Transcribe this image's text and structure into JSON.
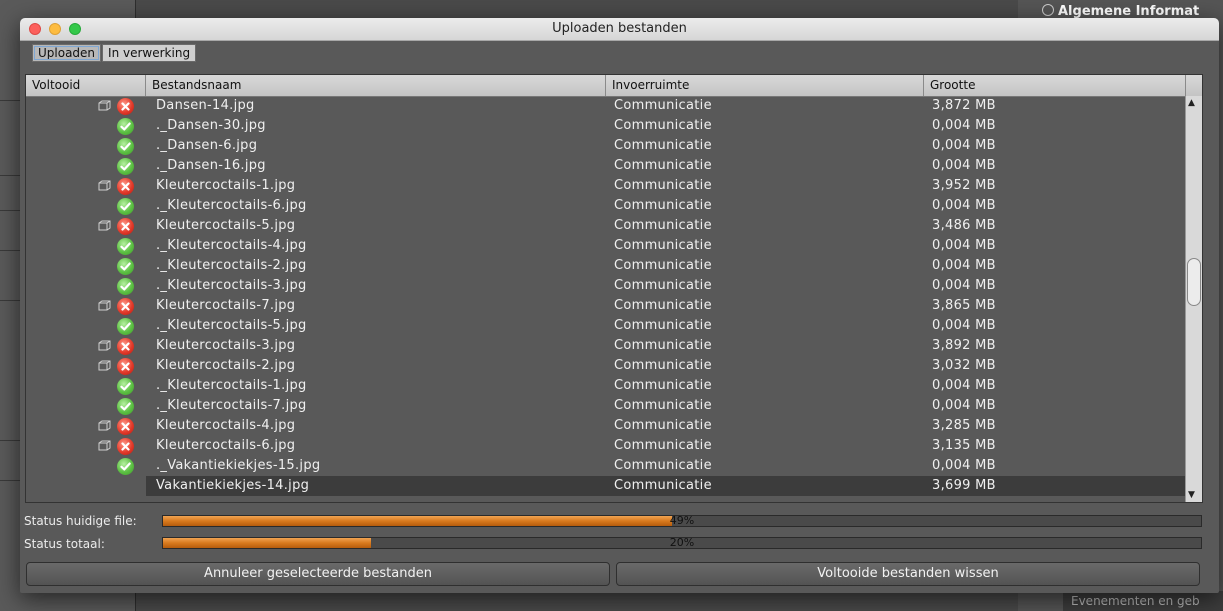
{
  "window": {
    "title": "Uploaden bestanden"
  },
  "tabs": [
    {
      "label": "Uploaden",
      "active": true
    },
    {
      "label": "In verwerking",
      "active": false
    }
  ],
  "table": {
    "columns": [
      "Voltooid",
      "Bestandsnaam",
      "Invoerruimte",
      "Grootte"
    ],
    "rows": [
      {
        "status": "error",
        "name": "Dansen-14.jpg",
        "space": "Communicatie",
        "size": "3,872 MB"
      },
      {
        "status": "ok",
        "name": "._Dansen-30.jpg",
        "space": "Communicatie",
        "size": "0,004 MB"
      },
      {
        "status": "ok",
        "name": "._Dansen-6.jpg",
        "space": "Communicatie",
        "size": "0,004 MB"
      },
      {
        "status": "ok",
        "name": "._Dansen-16.jpg",
        "space": "Communicatie",
        "size": "0,004 MB"
      },
      {
        "status": "error",
        "name": "Kleutercoctails-1.jpg",
        "space": "Communicatie",
        "size": "3,952 MB"
      },
      {
        "status": "ok",
        "name": "._Kleutercoctails-6.jpg",
        "space": "Communicatie",
        "size": "0,004 MB"
      },
      {
        "status": "error",
        "name": "Kleutercoctails-5.jpg",
        "space": "Communicatie",
        "size": "3,486 MB"
      },
      {
        "status": "ok",
        "name": "._Kleutercoctails-4.jpg",
        "space": "Communicatie",
        "size": "0,004 MB"
      },
      {
        "status": "ok",
        "name": "._Kleutercoctails-2.jpg",
        "space": "Communicatie",
        "size": "0,004 MB"
      },
      {
        "status": "ok",
        "name": "._Kleutercoctails-3.jpg",
        "space": "Communicatie",
        "size": "0,004 MB"
      },
      {
        "status": "error",
        "name": "Kleutercoctails-7.jpg",
        "space": "Communicatie",
        "size": "3,865 MB"
      },
      {
        "status": "ok",
        "name": "._Kleutercoctails-5.jpg",
        "space": "Communicatie",
        "size": "0,004 MB"
      },
      {
        "status": "error",
        "name": "Kleutercoctails-3.jpg",
        "space": "Communicatie",
        "size": "3,892 MB"
      },
      {
        "status": "error",
        "name": "Kleutercoctails-2.jpg",
        "space": "Communicatie",
        "size": "3,032 MB"
      },
      {
        "status": "ok",
        "name": "._Kleutercoctails-1.jpg",
        "space": "Communicatie",
        "size": "0,004 MB"
      },
      {
        "status": "ok",
        "name": "._Kleutercoctails-7.jpg",
        "space": "Communicatie",
        "size": "0,004 MB"
      },
      {
        "status": "error",
        "name": "Kleutercoctails-4.jpg",
        "space": "Communicatie",
        "size": "3,285 MB"
      },
      {
        "status": "error",
        "name": "Kleutercoctails-6.jpg",
        "space": "Communicatie",
        "size": "3,135 MB"
      },
      {
        "status": "ok",
        "name": "._Vakantiekiekjes-15.jpg",
        "space": "Communicatie",
        "size": "0,004 MB"
      },
      {
        "status": "none",
        "name": "Vakantiekiekjes-14.jpg",
        "space": "Communicatie",
        "size": "3,699 MB",
        "selected": true
      }
    ]
  },
  "status": {
    "current_label": "Status huidige file:",
    "current_percent": 49,
    "current_text": "49%",
    "total_label": "Status totaal:",
    "total_percent": 20,
    "total_text": "20%"
  },
  "buttons": {
    "cancel_selected": "Annuleer geselecteerde bestanden",
    "clear_completed": "Voltooide bestanden wissen"
  },
  "background": {
    "right_panel_title": "Algemene Informat",
    "footer_text": "Evenementen en geb"
  },
  "icons": {
    "ok": "checkmark-circle-icon",
    "error": "error-circle-icon",
    "folder": "folder-icon"
  },
  "colors": {
    "progress": "#d87a1e",
    "ok": "#5cc043",
    "error": "#e43b2b"
  }
}
